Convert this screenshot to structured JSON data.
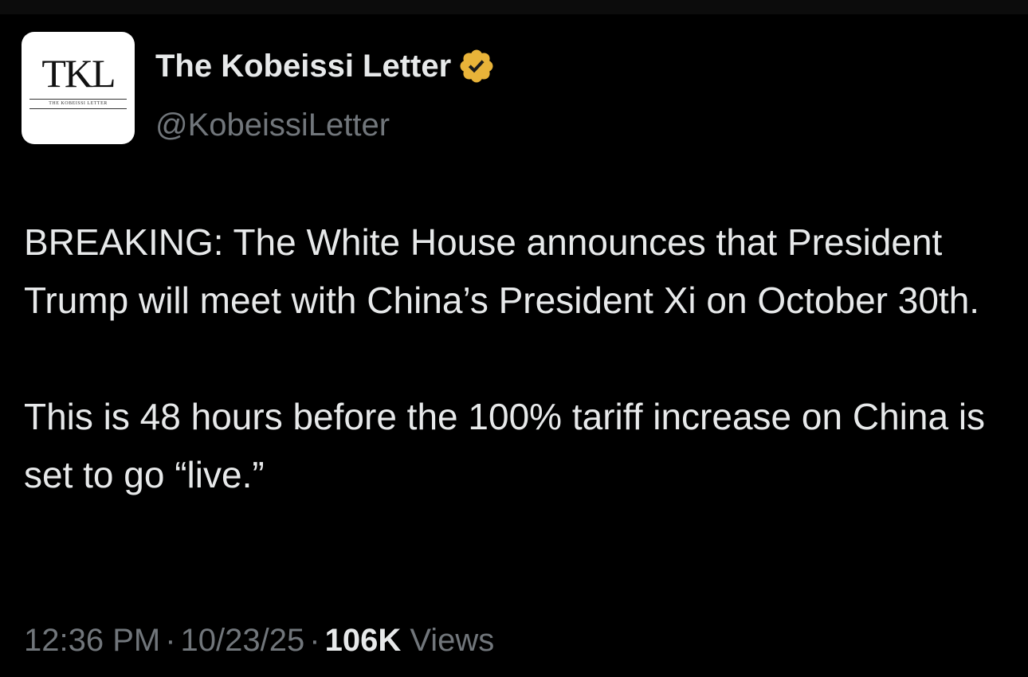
{
  "author": {
    "display_name": "The Kobeissi Letter",
    "handle": "@KobeissiLetter",
    "verified_badge_icon": "verified-gold-badge-icon",
    "badge_color": "#e8b339",
    "avatar": {
      "logo_text": "TKL",
      "logo_subtext": "THE KOBEISSI LETTER"
    }
  },
  "tweet": {
    "paragraphs": [
      "BREAKING: The White House announces that President Trump will meet with China’s President Xi on October 30th.",
      "This is 48 hours before the 100% tariff increase on China is set to go “live.”"
    ]
  },
  "meta": {
    "time": "12:36 PM",
    "separator": "·",
    "date": "10/23/25",
    "views_count": "106K",
    "views_label": "Views"
  },
  "colors": {
    "background": "#000000",
    "text_primary": "#e7e9ea",
    "text_secondary": "#71767b"
  }
}
